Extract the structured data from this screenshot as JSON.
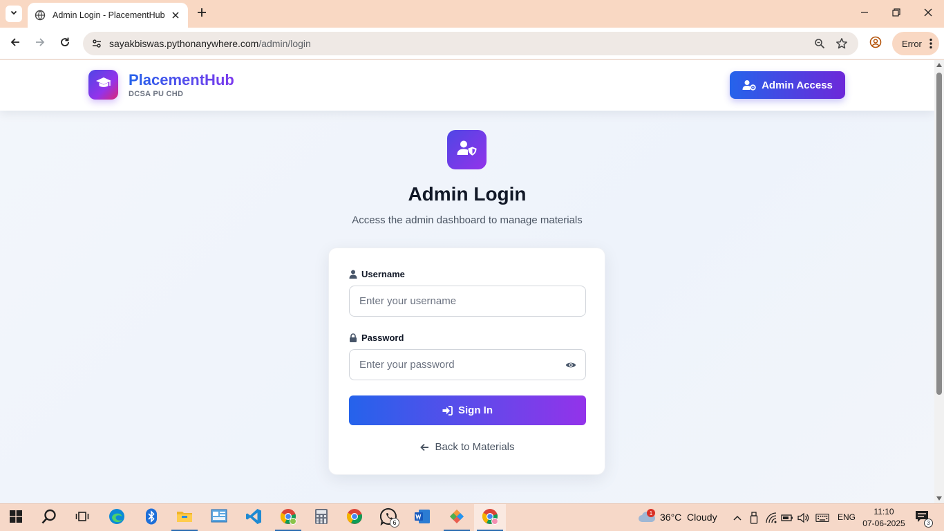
{
  "browser": {
    "tab_title": "Admin Login - PlacementHub",
    "url_host": "sayakbiswas.pythonanywhere.com",
    "url_path": "/admin/login",
    "profile_chip": "Error"
  },
  "header": {
    "brand_name": "PlacementHub",
    "brand_sub": "DCSA PU CHD",
    "admin_button": "Admin Access"
  },
  "login": {
    "title": "Admin Login",
    "subtitle": "Access the admin dashboard to manage materials",
    "username_label": "Username",
    "username_placeholder": "Enter your username",
    "password_label": "Password",
    "password_placeholder": "Enter your password",
    "signin_label": "Sign In",
    "back_label": "Back to Materials"
  },
  "taskbar": {
    "weather_temp": "36°C",
    "weather_desc": "Cloudy",
    "weather_alert": "1",
    "language": "ENG",
    "time": "11:10",
    "date": "07-06-2025",
    "whatsapp_badge": "6",
    "notifications": "3"
  },
  "colors": {
    "accent_blue": "#2563eb",
    "accent_purple": "#9333ea",
    "chrome_bg": "#f9d8c3"
  }
}
